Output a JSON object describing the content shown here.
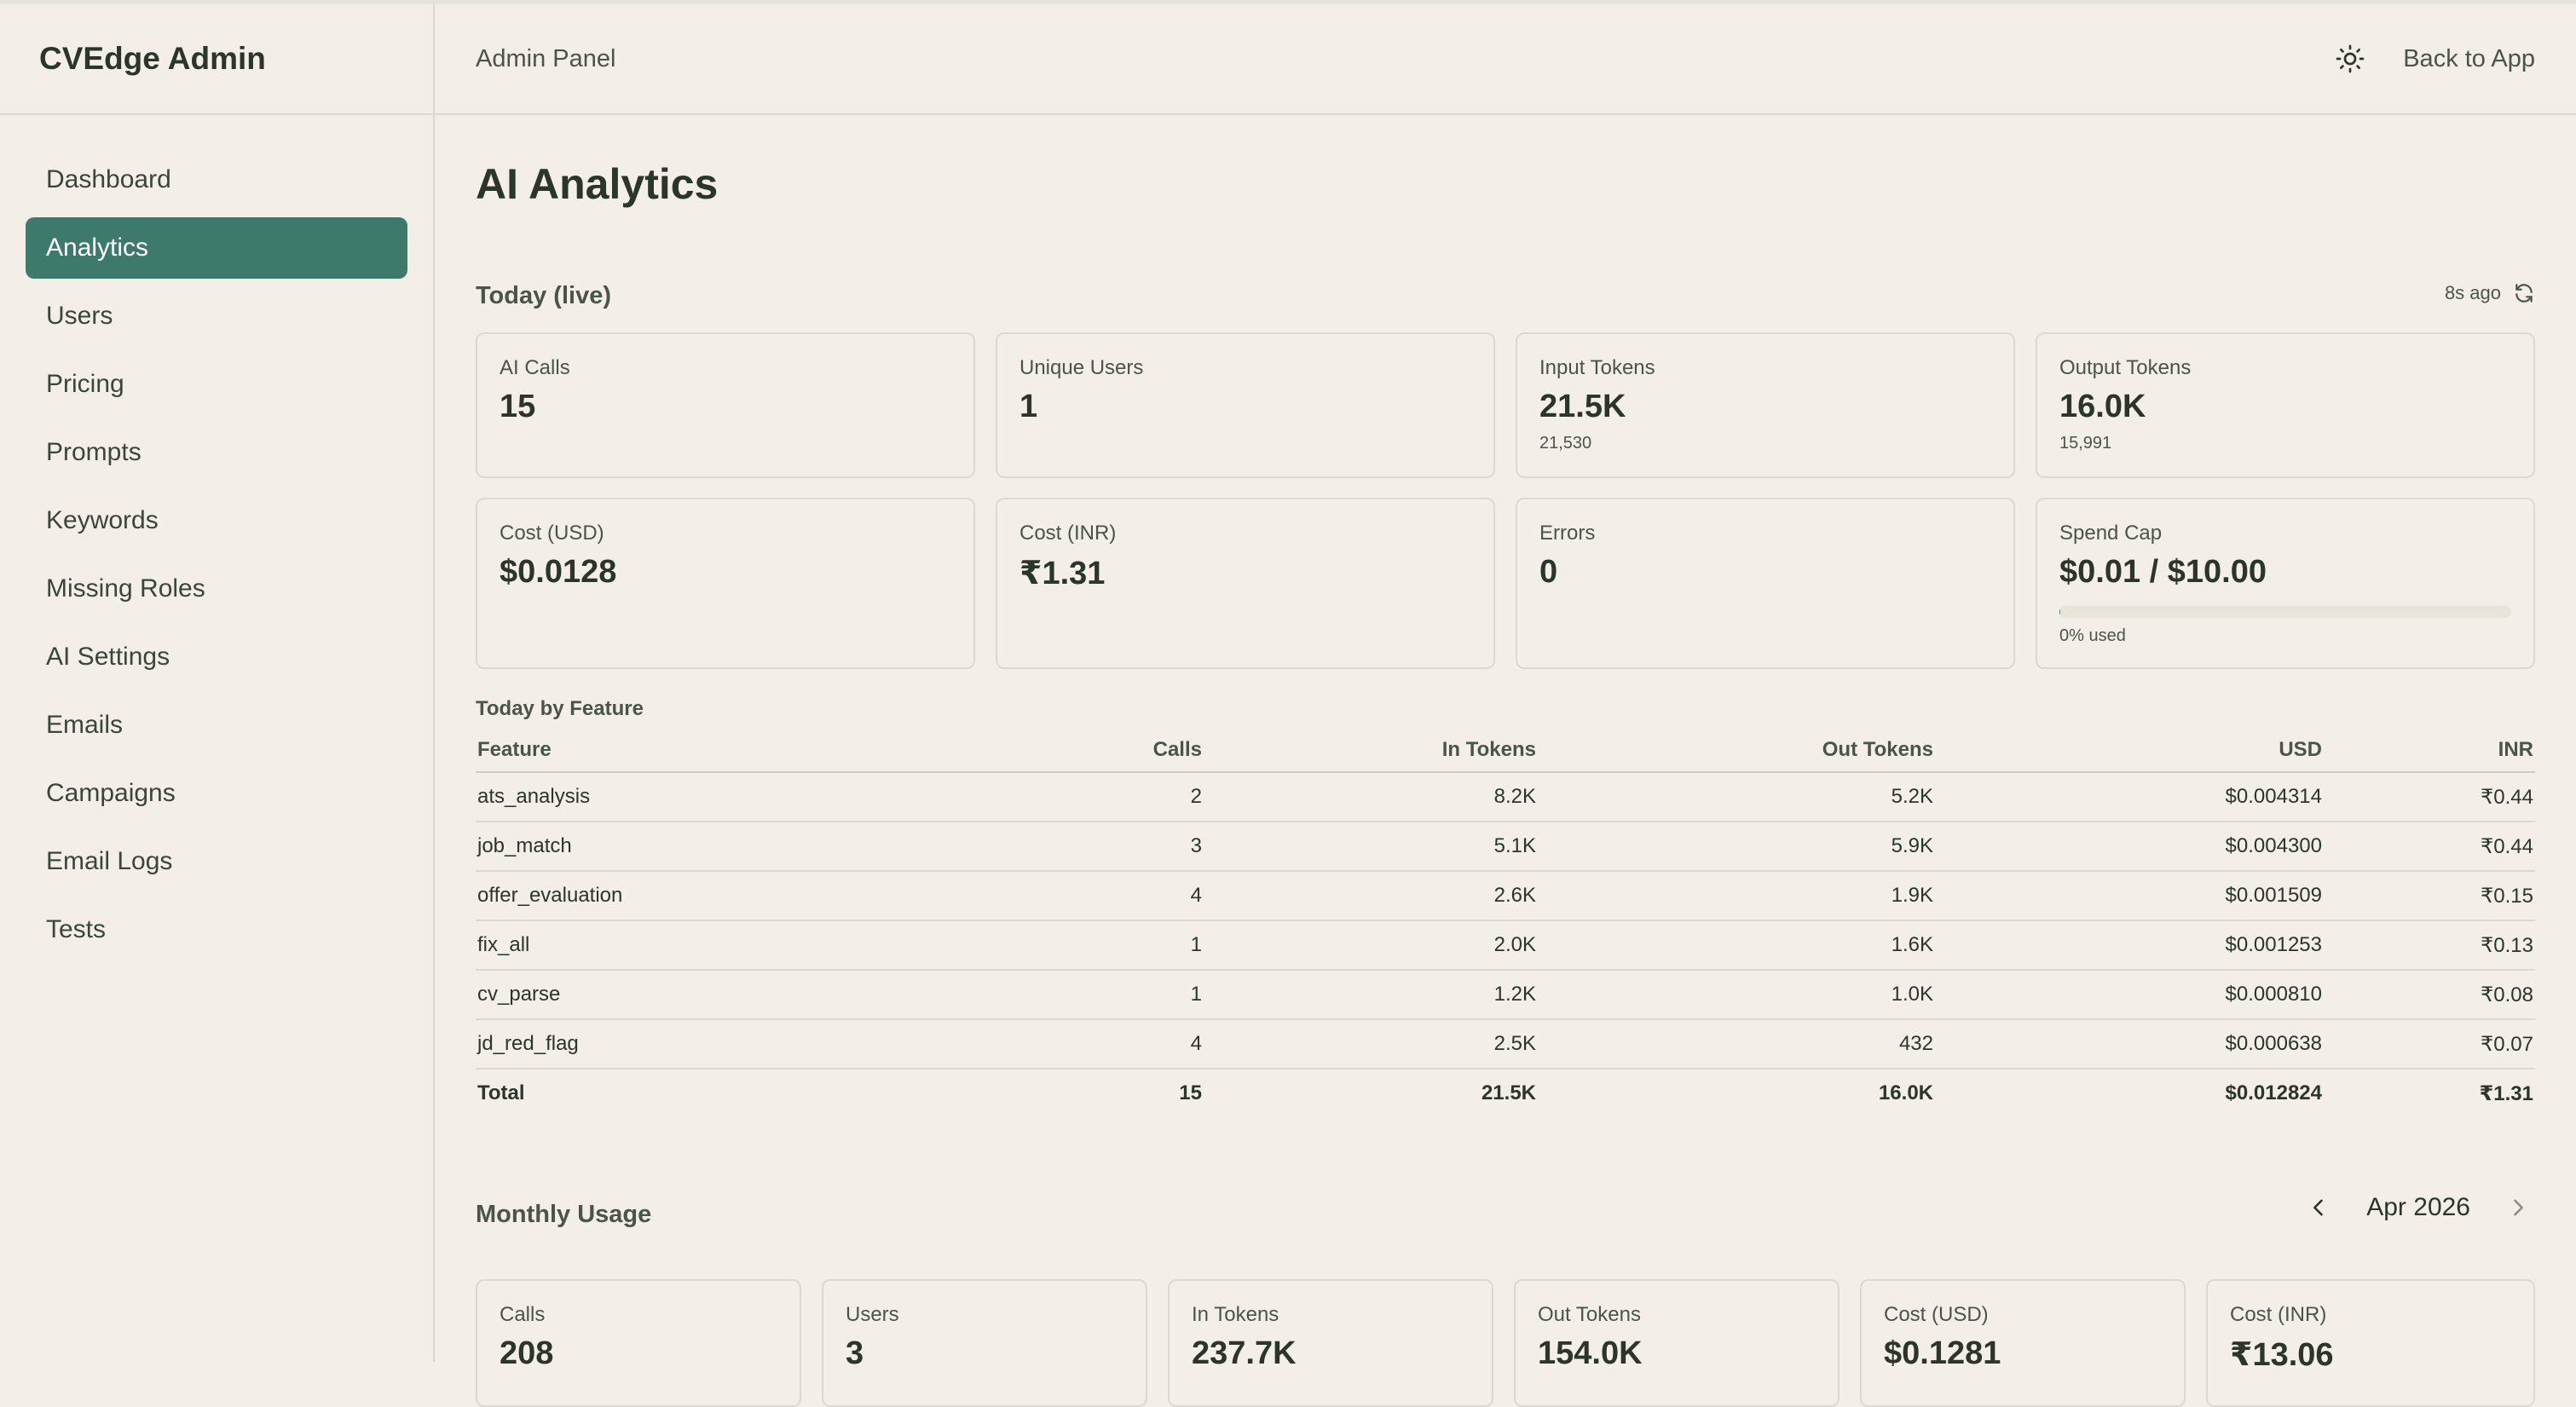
{
  "app": {
    "brand": "CVEdge Admin"
  },
  "header": {
    "title": "Admin Panel",
    "back_label": "Back to App",
    "theme_icon": "sun-icon"
  },
  "sidebar": {
    "items": [
      {
        "label": "Dashboard",
        "active": false
      },
      {
        "label": "Analytics",
        "active": true
      },
      {
        "label": "Users",
        "active": false
      },
      {
        "label": "Pricing",
        "active": false
      },
      {
        "label": "Prompts",
        "active": false
      },
      {
        "label": "Keywords",
        "active": false
      },
      {
        "label": "Missing Roles",
        "active": false
      },
      {
        "label": "AI Settings",
        "active": false
      },
      {
        "label": "Emails",
        "active": false
      },
      {
        "label": "Campaigns",
        "active": false
      },
      {
        "label": "Email Logs",
        "active": false
      },
      {
        "label": "Tests",
        "active": false
      }
    ]
  },
  "page": {
    "title": "AI Analytics"
  },
  "today": {
    "title": "Today (live)",
    "updated": "8s ago",
    "cards": [
      {
        "label": "AI Calls",
        "value": "15",
        "sub": ""
      },
      {
        "label": "Unique Users",
        "value": "1",
        "sub": ""
      },
      {
        "label": "Input Tokens",
        "value": "21.5K",
        "sub": "21,530"
      },
      {
        "label": "Output Tokens",
        "value": "16.0K",
        "sub": "15,991"
      },
      {
        "label": "Cost (USD)",
        "value": "$0.0128",
        "sub": ""
      },
      {
        "label": "Cost (INR)",
        "value": "₹1.31",
        "sub": ""
      },
      {
        "label": "Errors",
        "value": "0",
        "sub": ""
      },
      {
        "label": "Spend Cap",
        "value": "$0.01 / $10.00",
        "sub": "0% used",
        "progress": 0.0013
      }
    ]
  },
  "by_feature": {
    "title": "Today by Feature",
    "columns": [
      "Feature",
      "Calls",
      "In Tokens",
      "Out Tokens",
      "USD",
      "INR"
    ],
    "rows": [
      [
        "ats_analysis",
        "2",
        "8.2K",
        "5.2K",
        "$0.004314",
        "₹0.44"
      ],
      [
        "job_match",
        "3",
        "5.1K",
        "5.9K",
        "$0.004300",
        "₹0.44"
      ],
      [
        "offer_evaluation",
        "4",
        "2.6K",
        "1.9K",
        "$0.001509",
        "₹0.15"
      ],
      [
        "fix_all",
        "1",
        "2.0K",
        "1.6K",
        "$0.001253",
        "₹0.13"
      ],
      [
        "cv_parse",
        "1",
        "1.2K",
        "1.0K",
        "$0.000810",
        "₹0.08"
      ],
      [
        "jd_red_flag",
        "4",
        "2.5K",
        "432",
        "$0.000638",
        "₹0.07"
      ]
    ],
    "total": [
      "Total",
      "15",
      "21.5K",
      "16.0K",
      "$0.012824",
      "₹1.31"
    ]
  },
  "monthly": {
    "title": "Monthly Usage",
    "month": "Apr 2026",
    "cards": [
      {
        "label": "Calls",
        "value": "208"
      },
      {
        "label": "Users",
        "value": "3"
      },
      {
        "label": "In Tokens",
        "value": "237.7K"
      },
      {
        "label": "Out Tokens",
        "value": "154.0K"
      },
      {
        "label": "Cost (USD)",
        "value": "$0.1281"
      },
      {
        "label": "Cost (INR)",
        "value": "₹13.06"
      }
    ]
  }
}
